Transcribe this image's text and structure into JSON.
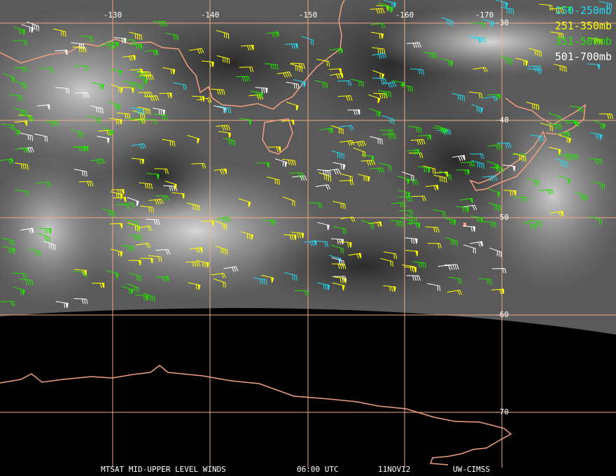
{
  "title": "MTSAT MID-UPPER LEVEL WINDS",
  "time": "06:00 UTC",
  "date": "11NOV12",
  "credit": "UW-CIMSS",
  "longitude_labels": [
    "-130",
    "-140",
    "-150",
    "-160",
    "-170"
  ],
  "latitude_labels": [
    "-30",
    "-40",
    "-50",
    "-60",
    "-70"
  ],
  "legend": [
    {
      "label": "150-250mb",
      "color": "#22d8f0"
    },
    {
      "label": "251-350mb",
      "color": "#ffff00"
    },
    {
      "label": "351-500mb",
      "color": "#22e000"
    },
    {
      "label": "501-700mb",
      "color": "#ffffff"
    }
  ],
  "colors": {
    "gridline": "#f0a888",
    "coastline": "#f0a080",
    "background_no_data": "#000000"
  }
}
